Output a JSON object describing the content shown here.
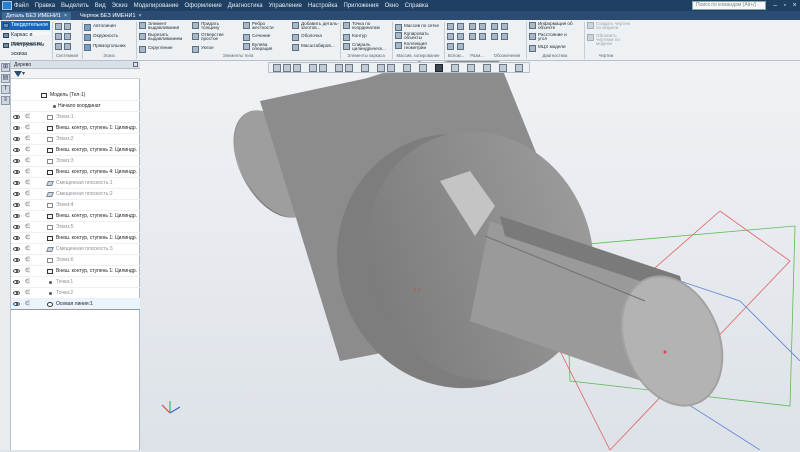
{
  "menubar": {
    "items": [
      "Файл",
      "Правка",
      "Выделить",
      "Вид",
      "Эскиз",
      "Моделирование",
      "Оформление",
      "Диагностика",
      "Управление",
      "Настройка",
      "Приложения",
      "Окно",
      "Справка"
    ],
    "search_placeholder": "Поиск по командам (Alt+/)"
  },
  "tabs": [
    {
      "label": "Деталь БЕЗ ИМЕНИ1"
    },
    {
      "label": "Чертеж БЕЗ ИМЕНИ1"
    }
  ],
  "modes": [
    {
      "label": "Твердотельное моделирование"
    },
    {
      "label": "Каркас и поверхности"
    },
    {
      "label": "Инструменты эскиза"
    }
  ],
  "ribbon": {
    "c1": [
      "Автолиния",
      "Окружность",
      "Прямоугольник"
    ],
    "c2": [
      "Элемент выдавливания",
      "Вырезать выдавливанием",
      "Скругление"
    ],
    "c3": [
      "Придать толщину",
      "Отверстие простое",
      "Уклон"
    ],
    "c4": [
      "Ребро жесткости",
      "Сечение",
      "Булева операция"
    ],
    "c5": [
      "Добавить деталь-заготов...",
      "Оболочка",
      "Масштабиров..."
    ],
    "c6": [
      "Точка по координатам",
      "Контур",
      "Спираль цилиндрическ..."
    ],
    "c7": [
      "Массив по сетке",
      "Копировать объекты",
      "Коллекция геометрии"
    ],
    "c8": [
      "Информация об объекте",
      "Расстояние и угол",
      "МЦХ модели"
    ],
    "c9": [
      "Создать чертеж по модели",
      "Обновить чертежи по модели"
    ],
    "groups": [
      "Системная",
      "Эскиз",
      "Элементы тела",
      "Элементы каркаса",
      "Массив, копирование",
      "Вспом...",
      "Разм...",
      "Обозначения",
      "Диагностика",
      "Чертеж"
    ]
  },
  "panel": {
    "title": "Дерево",
    "rows": [
      {
        "label": "Модель (Тел-1)",
        "icon": "model"
      },
      {
        "label": "Начало координат",
        "icon": "origin"
      },
      {
        "label": "Эскиз:1",
        "icon": "sketch",
        "dim": true
      },
      {
        "label": "Внеш. контур, ступень 1: Цилиндр.",
        "icon": "body"
      },
      {
        "label": "Эскиз:2",
        "icon": "sketch",
        "dim": true
      },
      {
        "label": "Внеш. контур, ступень 2: Цилиндр.",
        "icon": "body"
      },
      {
        "label": "Эскиз:3",
        "icon": "sketch",
        "dim": true
      },
      {
        "label": "Внеш. контур, ступень 4: Цилиндр.",
        "icon": "body"
      },
      {
        "label": "Смещенная плоскость:1",
        "icon": "plane",
        "dim": true
      },
      {
        "label": "Смещенная плоскость:2",
        "icon": "plane",
        "dim": true
      },
      {
        "label": "Эскиз:4",
        "icon": "sketch",
        "dim": true
      },
      {
        "label": "Внеш. контур, ступень 1: Цилиндр.",
        "icon": "body"
      },
      {
        "label": "Эскиз:5",
        "icon": "sketch",
        "dim": true
      },
      {
        "label": "Внеш. контур, ступень 1: Цилиндр.",
        "icon": "body"
      },
      {
        "label": "Смещенная плоскость:3",
        "icon": "plane",
        "dim": true
      },
      {
        "label": "Эскиз:6",
        "icon": "sketch",
        "dim": true
      },
      {
        "label": "Внеш. контур, ступень 1: Цилиндр.",
        "icon": "body"
      },
      {
        "label": "Точка:1",
        "icon": "point",
        "dim": true
      },
      {
        "label": "Точка:2",
        "icon": "point",
        "dim": true
      },
      {
        "label": "Осевая линия:1",
        "icon": "axis",
        "selected": true
      }
    ]
  },
  "colors": {
    "accent": "#1c64b4",
    "menubar": "#1f3f63",
    "model": "#8e8e8e"
  }
}
